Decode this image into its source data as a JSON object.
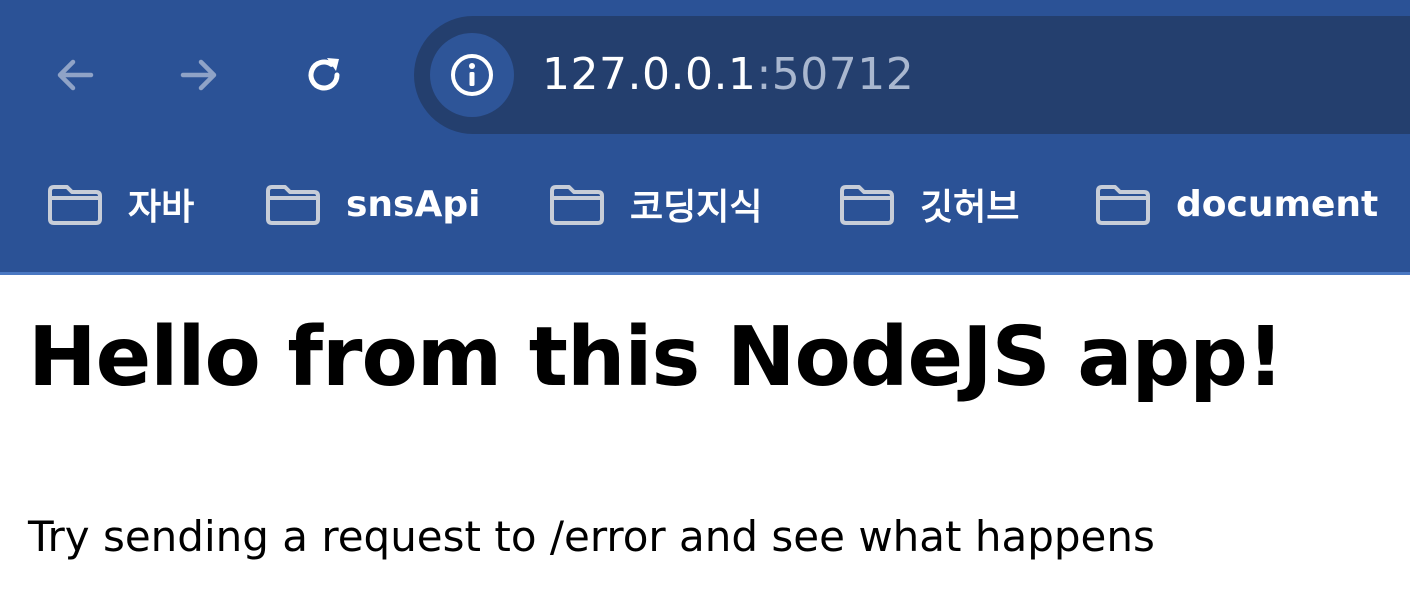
{
  "toolbar": {
    "back_icon": "arrow-left-icon",
    "forward_icon": "arrow-right-icon",
    "reload_icon": "reload-icon",
    "site_info_icon": "info-icon"
  },
  "address_bar": {
    "host": "127.0.0.1",
    "port": ":50712"
  },
  "bookmarks": [
    {
      "label": "자바",
      "icon": "folder-icon"
    },
    {
      "label": "snsApi",
      "icon": "folder-icon"
    },
    {
      "label": "코딩지식",
      "icon": "folder-icon"
    },
    {
      "label": "깃허브",
      "icon": "folder-icon"
    },
    {
      "label": "document",
      "icon": "folder-icon"
    }
  ],
  "page": {
    "heading": "Hello from this NodeJS app!",
    "text": "Try sending a request to /error and see what happens"
  },
  "colors": {
    "chrome_bg": "#2b5296",
    "omnibox_bg": "#243f6e",
    "text_primary": "#000000"
  }
}
